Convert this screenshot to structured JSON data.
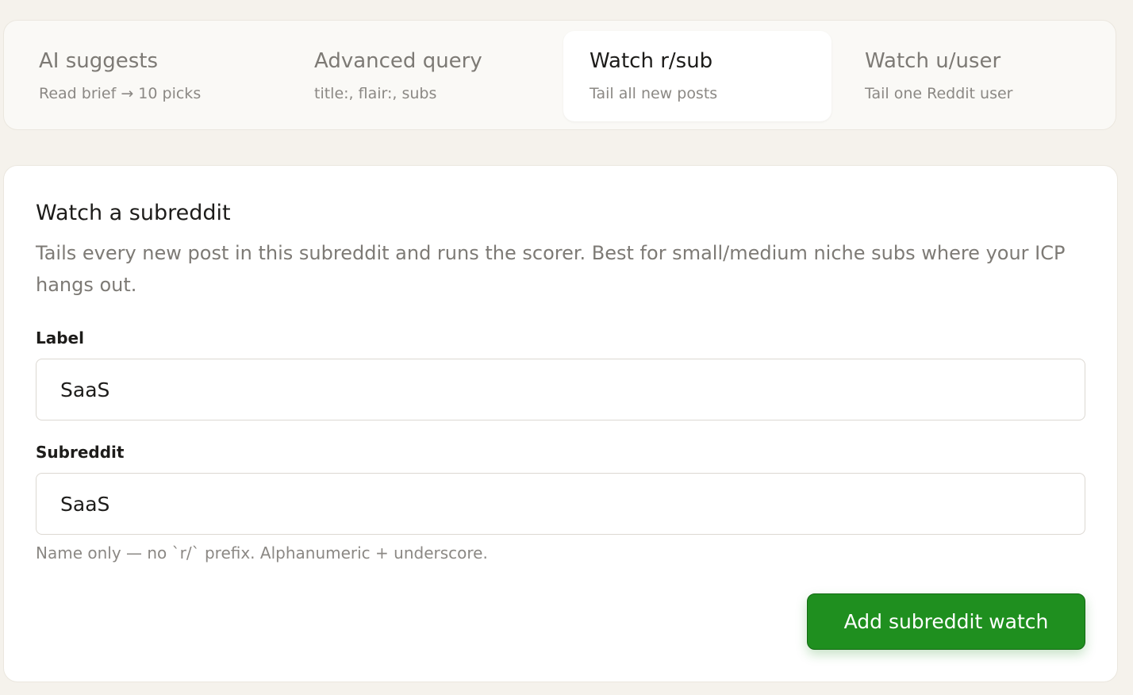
{
  "tabs": [
    {
      "title": "AI suggests",
      "subtitle": "Read brief → 10 picks",
      "active": false
    },
    {
      "title": "Advanced query",
      "subtitle": "title:, flair:, subs",
      "active": false
    },
    {
      "title": "Watch r/sub",
      "subtitle": "Tail all new posts",
      "active": true
    },
    {
      "title": "Watch u/user",
      "subtitle": "Tail one Reddit user",
      "active": false
    }
  ],
  "form": {
    "heading": "Watch a subreddit",
    "description": "Tails every new post in this subreddit and runs the scorer. Best for small/medium niche subs where your ICP hangs out.",
    "label_field": {
      "label": "Label",
      "value": "SaaS"
    },
    "subreddit_field": {
      "label": "Subreddit",
      "value": "SaaS"
    },
    "hint": "Name only — no `r/` prefix. Alphanumeric + underscore.",
    "submit_label": "Add subreddit watch"
  },
  "colors": {
    "accent": "#1f8f1f",
    "background": "#f5f2ec"
  }
}
